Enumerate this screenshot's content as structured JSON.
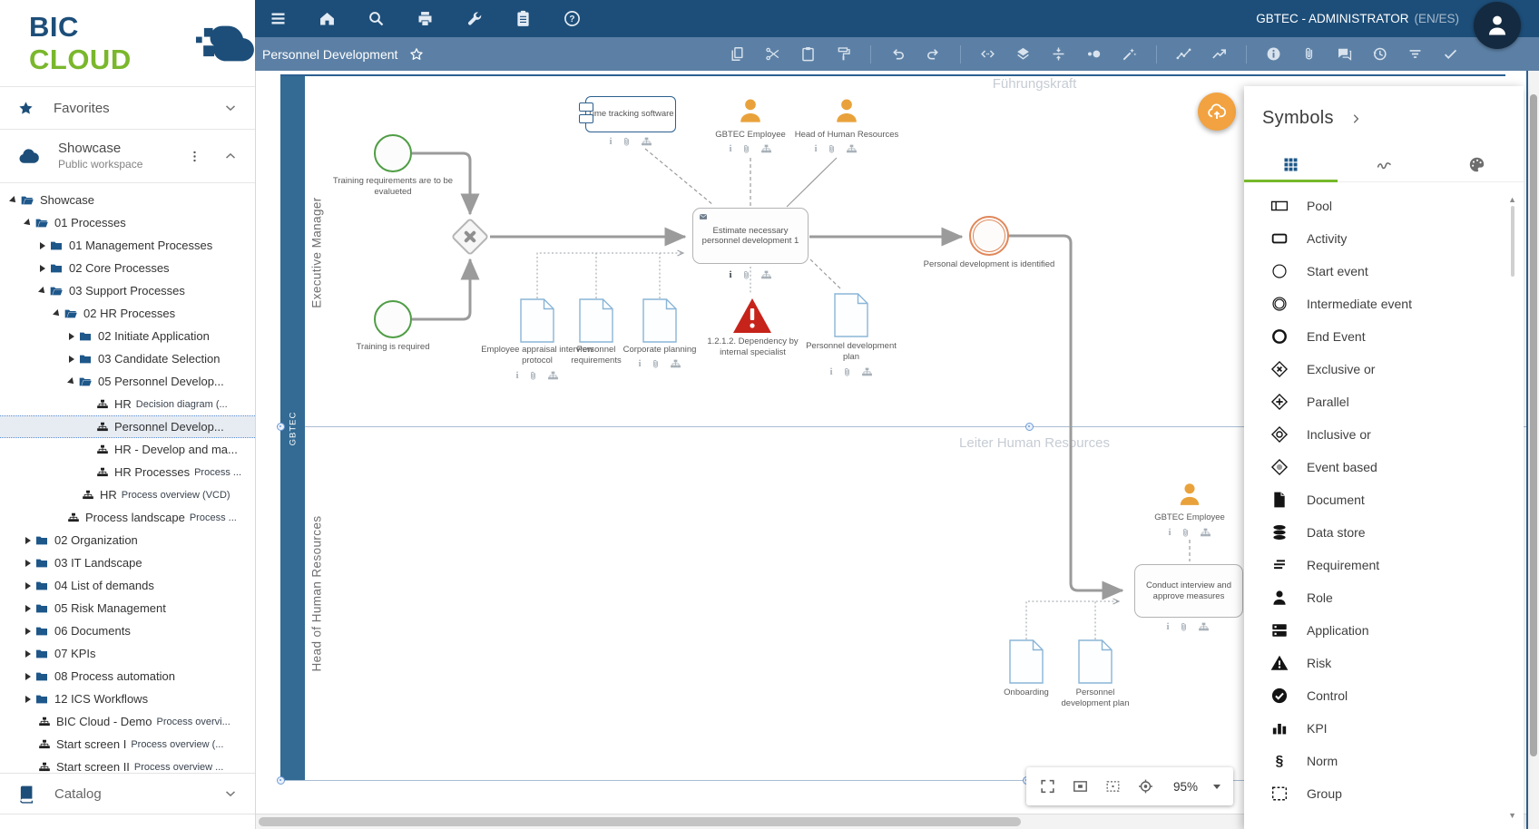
{
  "logo": {
    "primary": "BIC",
    "secondary": "CLOUD"
  },
  "topbar": {
    "icons": [
      "menu",
      "home",
      "search",
      "print",
      "tools",
      "tasks",
      "help"
    ],
    "user": "GBTEC - ADMINISTRATOR",
    "lang": "(EN/ES)"
  },
  "toolbar": {
    "title": "Personnel Development",
    "groups": [
      [
        "copy",
        "cut",
        "paste",
        "format-paint"
      ],
      [
        "undo",
        "redo"
      ],
      [
        "code",
        "layers",
        "align-vertical",
        "reduce",
        "magic-wand"
      ],
      [
        "polyline",
        "trend-up"
      ],
      [
        "info",
        "attachment",
        "comment",
        "history",
        "filter",
        "check"
      ]
    ]
  },
  "sidebar": {
    "favorites": "Favorites",
    "workspace_title": "Showcase",
    "workspace_subtitle": "Public workspace",
    "catalog": "Catalog",
    "tree": [
      {
        "level": 0,
        "caret": "open",
        "icon": "folder-open",
        "label": "Showcase",
        "sublabel": ""
      },
      {
        "level": 1,
        "caret": "open",
        "icon": "folder-open",
        "label": "01 Processes",
        "sublabel": ""
      },
      {
        "level": 2,
        "caret": "closed",
        "icon": "folder",
        "label": "01 Management Processes",
        "sublabel": ""
      },
      {
        "level": 2,
        "caret": "closed",
        "icon": "folder",
        "label": "02 Core Processes",
        "sublabel": ""
      },
      {
        "level": 2,
        "caret": "open",
        "icon": "folder-open",
        "label": "03 Support Processes",
        "sublabel": ""
      },
      {
        "level": 3,
        "caret": "open",
        "icon": "folder-open",
        "label": "02 HR Processes",
        "sublabel": ""
      },
      {
        "level": 4,
        "caret": "closed",
        "icon": "folder",
        "label": "02 Initiate Application",
        "sublabel": ""
      },
      {
        "level": 4,
        "caret": "closed",
        "icon": "folder",
        "label": "03 Candidate Selection",
        "sublabel": ""
      },
      {
        "level": 4,
        "caret": "open",
        "icon": "folder-open",
        "label": "05 Personnel Develop...",
        "sublabel": ""
      },
      {
        "level": 5,
        "caret": "none",
        "icon": "diagram",
        "label": "HR",
        "sublabel": "Decision diagram (..."
      },
      {
        "level": 5,
        "caret": "none",
        "icon": "diagram",
        "label": "Personnel Develop...",
        "sublabel": "",
        "selected": true
      },
      {
        "level": 5,
        "caret": "none",
        "icon": "diagram",
        "label": "HR - Develop and ma...",
        "sublabel": ""
      },
      {
        "level": 5,
        "caret": "none",
        "icon": "diagram",
        "label": "HR Processes",
        "sublabel": "Process ..."
      },
      {
        "level": 4,
        "caret": "none",
        "icon": "diagram",
        "label": "HR",
        "sublabel": "Process overview (VCD)"
      },
      {
        "level": 3,
        "caret": "none",
        "icon": "diagram",
        "label": "Process landscape",
        "sublabel": "Process ..."
      },
      {
        "level": 1,
        "caret": "closed",
        "icon": "folder",
        "label": "02 Organization",
        "sublabel": ""
      },
      {
        "level": 1,
        "caret": "closed",
        "icon": "folder",
        "label": "03 IT Landscape",
        "sublabel": ""
      },
      {
        "level": 1,
        "caret": "closed",
        "icon": "folder",
        "label": "04 List of demands",
        "sublabel": ""
      },
      {
        "level": 1,
        "caret": "closed",
        "icon": "folder",
        "label": "05 Risk Management",
        "sublabel": ""
      },
      {
        "level": 1,
        "caret": "closed",
        "icon": "folder",
        "label": "06 Documents",
        "sublabel": ""
      },
      {
        "level": 1,
        "caret": "closed",
        "icon": "folder",
        "label": "07 KPIs",
        "sublabel": ""
      },
      {
        "level": 1,
        "caret": "closed",
        "icon": "folder",
        "label": "08 Process automation",
        "sublabel": ""
      },
      {
        "level": 1,
        "caret": "closed",
        "icon": "folder",
        "label": "12 ICS Workflows",
        "sublabel": ""
      },
      {
        "level": 1,
        "caret": "none",
        "icon": "diagram",
        "label": "BIC Cloud - Demo",
        "sublabel": "Process overvi..."
      },
      {
        "level": 1,
        "caret": "none",
        "icon": "diagram",
        "label": "Start screen I",
        "sublabel": "Process overview (..."
      },
      {
        "level": 1,
        "caret": "none",
        "icon": "diagram",
        "label": "Start screen II",
        "sublabel": "Process overview ..."
      }
    ]
  },
  "canvas": {
    "pool": "GBTEC",
    "lane1": "Executive Manager",
    "lane2": "Head of Human Resources",
    "watermark1": "Führungskraft",
    "watermark2": "Leiter Human Resources",
    "nodes": {
      "time_tracking": "Time tracking software",
      "employee_top": "GBTEC Employee",
      "head_hr_top": "Head of Human Resources",
      "start1": "Training requirements are to be evalueted",
      "start2": "Training is required",
      "estimate": "Estimate necessary personnel development 1",
      "doc_appraisal": "Employee appraisal interview protocol",
      "doc_requirements": "Personnel requirements",
      "doc_corporate": "Corporate planning",
      "risk": "1.2.1.2. Dependency by internal specialist",
      "doc_dev_plan_top": "Personnel development plan",
      "end_event": "Personal development is identified",
      "employee_bottom": "GBTEC Employee",
      "conduct": "Conduct interview and approve measures",
      "doc_onboarding": "Onboarding",
      "doc_dev_plan_bottom": "Personnel development plan"
    },
    "zoom": {
      "level": "95%",
      "icons": [
        "fullscreen",
        "fit-screen",
        "select-area",
        "target"
      ]
    }
  },
  "symbols_panel": {
    "title": "Symbols",
    "tabs": [
      "grid",
      "squiggle",
      "palette"
    ],
    "items": [
      {
        "icon": "pool",
        "label": "Pool"
      },
      {
        "icon": "activity",
        "label": "Activity"
      },
      {
        "icon": "start",
        "label": "Start event"
      },
      {
        "icon": "intermediate",
        "label": "Intermediate event"
      },
      {
        "icon": "end",
        "label": "End Event"
      },
      {
        "icon": "xor",
        "label": "Exclusive or"
      },
      {
        "icon": "parallel",
        "label": "Parallel"
      },
      {
        "icon": "inclusive",
        "label": "Inclusive or"
      },
      {
        "icon": "eventbased",
        "label": "Event based"
      },
      {
        "icon": "document",
        "label": "Document"
      },
      {
        "icon": "datastore",
        "label": "Data store"
      },
      {
        "icon": "requirement",
        "label": "Requirement"
      },
      {
        "icon": "role",
        "label": "Role"
      },
      {
        "icon": "application",
        "label": "Application"
      },
      {
        "icon": "risk",
        "label": "Risk"
      },
      {
        "icon": "control",
        "label": "Control"
      },
      {
        "icon": "kpi",
        "label": "KPI"
      },
      {
        "icon": "norm",
        "label": "Norm"
      },
      {
        "icon": "group",
        "label": "Group"
      }
    ]
  },
  "colors": {
    "brand_blue": "#1d4e79",
    "brand_green": "#76b82a",
    "toolbar_blue": "#5c80a5",
    "pool_blue": "#336b94",
    "person_orange": "#e9a23b",
    "start_green": "#4f9d45",
    "end_orange": "#e0875a",
    "doc_blue": "#8ab5d7",
    "risk_red": "#c6231b",
    "upload_orange": "#f2a240"
  }
}
